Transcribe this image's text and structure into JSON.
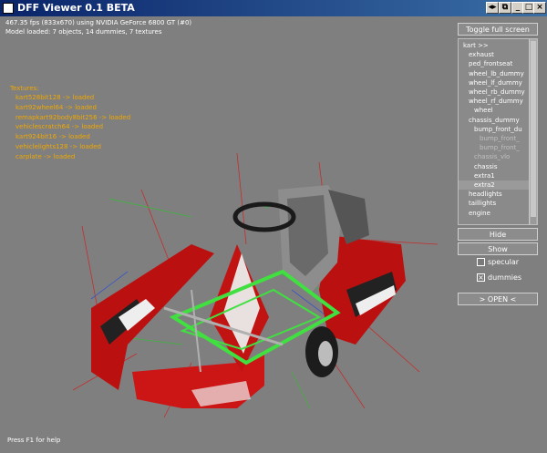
{
  "window": {
    "title": "DFF Viewer 0.1 BETA",
    "controls": [
      "◂▸",
      "⧉",
      "_",
      "□",
      "×"
    ]
  },
  "hud": {
    "fps_line": "467.35 fps (833x670) using NVIDIA GeForce 6800 GT (#0)",
    "model_line": "Model loaded: 7 objects, 14 dummies, 7 textures",
    "textures_title": "Textures:",
    "textures": [
      "kart528bit128 -> loaded",
      "kart92wheel64 -> loaded",
      "remapkart92body8bit256 -> loaded",
      "vehiclescratch64 -> loaded",
      "kart924bit16 -> loaded",
      "vehiclelights128 -> loaded",
      "carplate -> loaded"
    ],
    "help": "Press F1 for help"
  },
  "panel": {
    "toggle_fullscreen": "Toggle full screen",
    "tree_items": [
      {
        "label": "kart >>",
        "indent": 0,
        "dim": false
      },
      {
        "label": "exhaust",
        "indent": 1,
        "dim": false
      },
      {
        "label": "ped_frontseat",
        "indent": 1,
        "dim": false
      },
      {
        "label": "wheel_lb_dummy",
        "indent": 1,
        "dim": false
      },
      {
        "label": "wheel_lf_dummy",
        "indent": 1,
        "dim": false
      },
      {
        "label": "wheel_rb_dummy",
        "indent": 1,
        "dim": false
      },
      {
        "label": "wheel_rf_dummy",
        "indent": 1,
        "dim": false
      },
      {
        "label": "wheel",
        "indent": 2,
        "dim": false
      },
      {
        "label": "chassis_dummy",
        "indent": 1,
        "dim": false
      },
      {
        "label": "bump_front_du",
        "indent": 2,
        "dim": false
      },
      {
        "label": "bump_front_",
        "indent": 3,
        "dim": true
      },
      {
        "label": "bump_front_",
        "indent": 3,
        "dim": true
      },
      {
        "label": "chassis_vlo",
        "indent": 2,
        "dim": true
      },
      {
        "label": "chassis",
        "indent": 2,
        "dim": false
      },
      {
        "label": "extra1",
        "indent": 2,
        "dim": false
      },
      {
        "label": "extra2",
        "indent": 2,
        "dim": false
      },
      {
        "label": "headlights",
        "indent": 1,
        "dim": false
      },
      {
        "label": "taillights",
        "indent": 1,
        "dim": false
      },
      {
        "label": "engine",
        "indent": 1,
        "dim": false
      }
    ],
    "hide": "Hide",
    "show": "Show",
    "specular": "specular",
    "specular_checked": false,
    "dummies": "dummies",
    "dummies_checked": true,
    "open": "> OPEN <"
  },
  "colors": {
    "texture_text": "#f0a800",
    "background": "#7f7f7f",
    "kart_body": "#c01010",
    "chassis_frame": "#40e040"
  }
}
